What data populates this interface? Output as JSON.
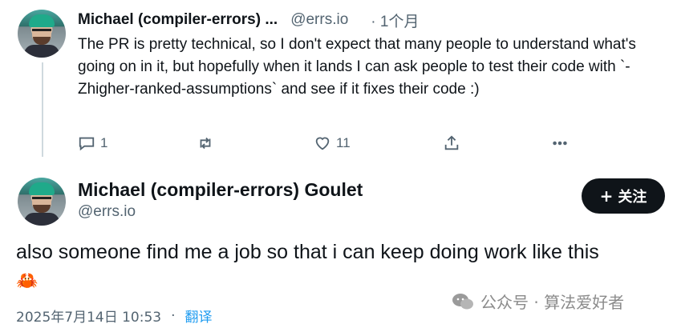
{
  "tweet1": {
    "display_name": "Michael (compiler-errors) ...",
    "handle": "@errs.io",
    "time": "· 1个月",
    "text": "The PR is pretty technical, so I don't expect that many people to understand what's going on in it, but hopefully when it lands I can ask people to test their code with `-Zhigher-ranked-assumptions` and see if it fixes their code :)",
    "reply_count": "1",
    "like_count": "11",
    "icons": {
      "reply": "reply-icon",
      "retweet": "retweet-icon",
      "like": "heart-icon",
      "share": "share-icon",
      "more": "more-icon"
    }
  },
  "tweet2": {
    "display_name": "Michael (compiler-errors) Goulet",
    "handle": "@errs.io",
    "follow_label": "关注",
    "text": "also someone find me a job so that i can keep doing work like this",
    "emoji": "🦀",
    "date": "2025年7月14日 10:53",
    "separator": "·",
    "translate": "翻译"
  },
  "watermark": {
    "text": "公众号 · 算法爱好者"
  },
  "colors": {
    "text_primary": "#0f1419",
    "text_secondary": "#536471",
    "follow_button_bg": "#0f1419",
    "link": "#1d9bf0",
    "thread_line": "#cfd9de"
  }
}
